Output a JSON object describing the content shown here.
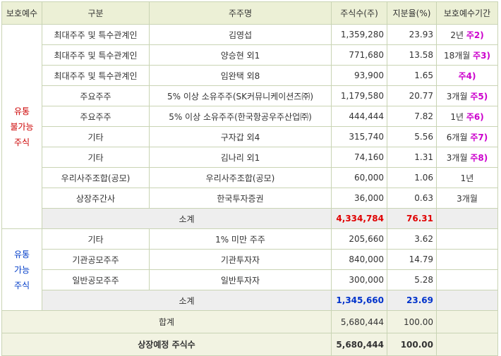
{
  "headers": [
    "보호예수",
    "구분",
    "주주명",
    "주식수(주)",
    "지분율(%)",
    "보호예수기간"
  ],
  "non_tradable": {
    "label_lines": [
      "유통",
      "불가능",
      "주식"
    ],
    "rows": [
      {
        "type": "최대주주 및 특수관계인",
        "name": "김영섭",
        "shares": "1,359,280",
        "pct": "23.93",
        "period": "2년 ",
        "note": "주2)"
      },
      {
        "type": "최대주주 및 특수관계인",
        "name": "양승현 외1",
        "shares": "771,680",
        "pct": "13.58",
        "period": "18개월 ",
        "note": "주3)"
      },
      {
        "type": "최대주주 및 특수관계인",
        "name": "임완택 외8",
        "shares": "93,900",
        "pct": "1.65",
        "period": "",
        "note": "주4)"
      },
      {
        "type": "주요주주",
        "name": "5% 이상 소유주주(SK커뮤니케이션즈㈜)",
        "shares": "1,179,580",
        "pct": "20.77",
        "period": "3개월 ",
        "note": "주5)"
      },
      {
        "type": "주요주주",
        "name": "5% 이상 소유주주(한국항공우주산업㈜)",
        "shares": "444,444",
        "pct": "7.82",
        "period": "1년 ",
        "note": "주6)"
      },
      {
        "type": "기타",
        "name": "구자갑 외4",
        "shares": "315,740",
        "pct": "5.56",
        "period": "6개월 ",
        "note": "주7)"
      },
      {
        "type": "기타",
        "name": "김나리 외1",
        "shares": "74,160",
        "pct": "1.31",
        "period": "3개월 ",
        "note": "주8)"
      },
      {
        "type": "우리사주조합(공모)",
        "name": "우리사주조합(공모)",
        "shares": "60,000",
        "pct": "1.06",
        "period": "1년",
        "note": ""
      },
      {
        "type": "상장주간사",
        "name": "한국투자증권",
        "shares": "36,000",
        "pct": "0.63",
        "period": "3개월",
        "note": ""
      }
    ],
    "subtotal": {
      "label": "소계",
      "shares": "4,334,784",
      "pct": "76.31"
    }
  },
  "tradable": {
    "label_lines": [
      "유통",
      "가능",
      "주식"
    ],
    "rows": [
      {
        "type": "기타",
        "name": "1% 미만 주주",
        "shares": "205,660",
        "pct": "3.62",
        "period": ""
      },
      {
        "type": "기관공모주주",
        "name": "기관투자자",
        "shares": "840,000",
        "pct": "14.79",
        "period": ""
      },
      {
        "type": "일반공모주주",
        "name": "일반투자자",
        "shares": "300,000",
        "pct": "5.28",
        "period": ""
      }
    ],
    "subtotal": {
      "label": "소계",
      "shares": "1,345,660",
      "pct": "23.69"
    }
  },
  "total": {
    "label": "합계",
    "shares": "5,680,444",
    "pct": "100.00"
  },
  "listing": {
    "label": "상장예정 주식수",
    "shares": "5,680,444",
    "pct": "100.00"
  }
}
